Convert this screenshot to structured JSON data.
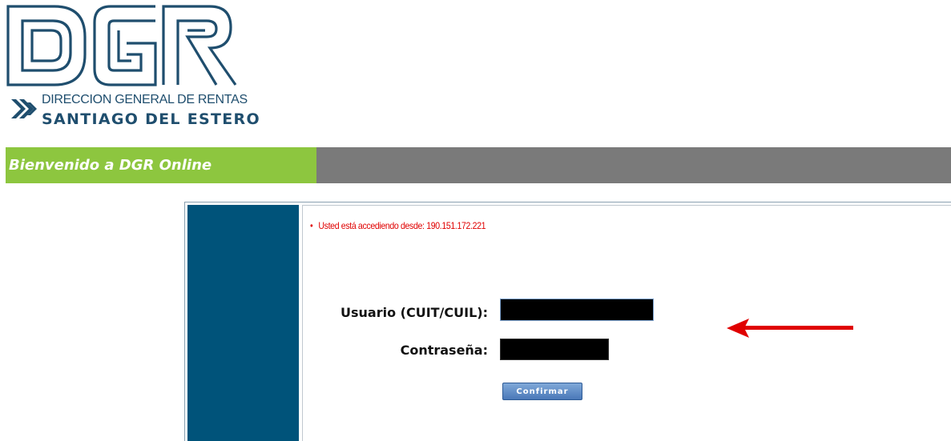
{
  "logo": {
    "letters": "DGR",
    "line1": "DIRECCION GENERAL DE RENTAS",
    "line2": "SANTIAGO DEL ESTERO",
    "color": "#1f4e6e"
  },
  "welcome": {
    "text": "Bienvenido a DGR Online",
    "accent_color": "#8dc63f",
    "bar_color": "#7a7a7a"
  },
  "login": {
    "ip_notice": "Usted está accediendo desde: 190.151.172.221",
    "user_label": "Usuario (CUIT/CUIL):",
    "user_value": "",
    "password_label": "Contraseña:",
    "password_value": "",
    "confirm_label": "Confirmar",
    "side_panel_color": "#00537a"
  },
  "annotation": {
    "arrow_icon": "red-arrow-left-icon",
    "arrow_color": "#e00000"
  }
}
